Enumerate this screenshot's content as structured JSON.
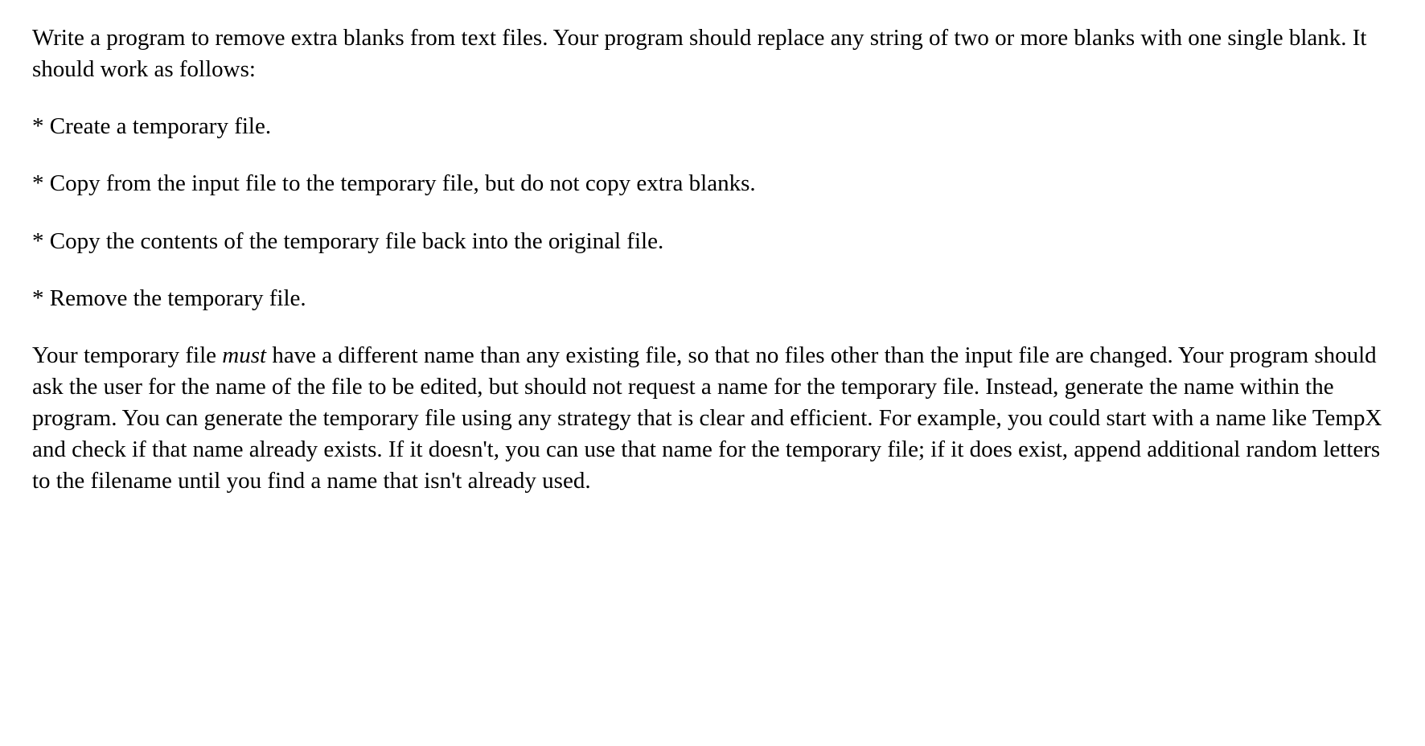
{
  "intro": "Write a program to remove extra blanks from text files. Your program should replace any string of two or more blanks with one single blank. It should work as follows:",
  "bullets": {
    "b1": "* Create a temporary file.",
    "b2": "* Copy from the input file to the temporary file, but do not copy extra blanks.",
    "b3": "* Copy the contents of the temporary file back into the original file.",
    "b4": "* Remove the temporary file."
  },
  "details": {
    "part1": "Your temporary file ",
    "emphasis": "must",
    "part2": " have a different name than any existing file, so that no files other than the input file are changed. Your program should ask the user for the name of the file to be edited, but should not request a name for the temporary file. Instead, generate the name within the program. You can generate the temporary file using any strategy that is clear and efficient. For example, you could start with a name like TempX and check if that name already exists. If it doesn't, you can use that name for the temporary file; if it does exist, append additional random letters to the filename until you find a name that isn't already used."
  }
}
